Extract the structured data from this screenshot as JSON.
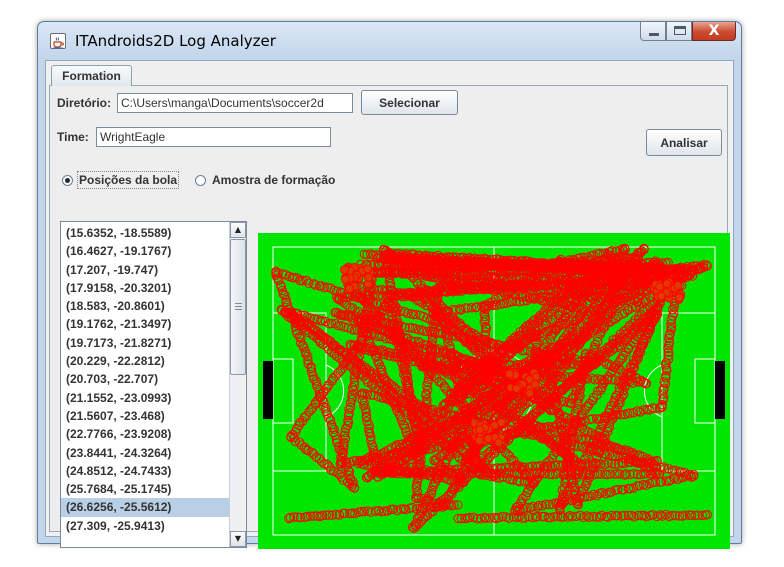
{
  "window": {
    "title": "ITAndroids2D Log Analyzer",
    "icon": "java-cup-icon",
    "controls": {
      "minimize": "minimize-icon",
      "maximize": "maximize-icon",
      "close": "X"
    }
  },
  "tabs": [
    {
      "label": "Formation",
      "selected": true
    }
  ],
  "form": {
    "directory_label": "Diretório:",
    "directory_value": "C:\\Users\\manga\\Documents\\soccer2d",
    "select_button": "Selecionar",
    "team_label": "Time:",
    "team_value": "WrightEagle",
    "analyze_button": "Analisar"
  },
  "mode": {
    "options": [
      {
        "label": "Posições da bola",
        "selected": true
      },
      {
        "label": "Amostra de formação",
        "selected": false
      }
    ]
  },
  "positions": {
    "items": [
      "(15.6352, -18.5589)",
      "(16.4627, -19.1767)",
      "(17.207, -19.747)",
      "(17.9158, -20.3201)",
      "(18.583, -20.8601)",
      "(19.1762, -21.3497)",
      "(19.7173, -21.8271)",
      "(20.229, -22.2812)",
      "(20.703, -22.707)",
      "(21.1552, -23.0993)",
      "(21.5607, -23.468)",
      "(22.7766, -23.9208)",
      "(23.8441, -24.3264)",
      "(24.8512, -24.7433)",
      "(25.7684, -25.1745)",
      "(26.6256, -25.5612)",
      "(27.309, -25.9413)"
    ],
    "selected_index": 15
  },
  "pitch": {
    "grass_color": "#00e600",
    "line_color": "#ffffff",
    "goal_color": "#000000",
    "marker_color": "#ff0000",
    "marker_fill": "#e03a00"
  }
}
